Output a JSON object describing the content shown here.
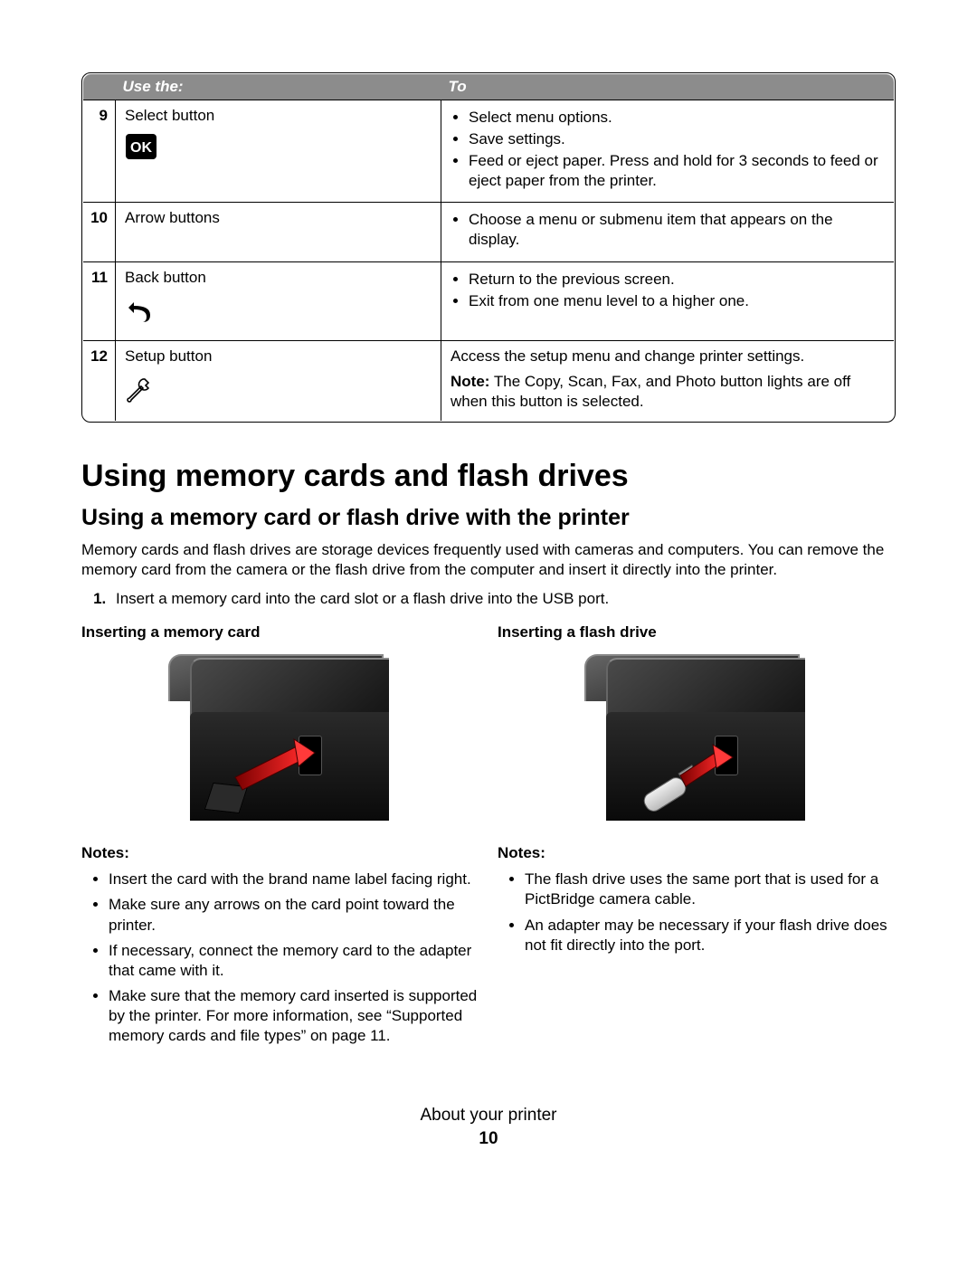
{
  "table": {
    "headers": {
      "num": "",
      "use": "Use the:",
      "to": "To"
    },
    "rows": [
      {
        "num": "9",
        "use": "Select button",
        "icon": "ok-icon",
        "to_items": [
          "Select menu options.",
          "Save settings.",
          "Feed or eject paper. Press and hold for 3 seconds to feed or eject paper from the printer."
        ]
      },
      {
        "num": "10",
        "use": "Arrow buttons",
        "to_items": [
          "Choose a menu or submenu item that appears on the display."
        ]
      },
      {
        "num": "11",
        "use": "Back button",
        "icon": "back-icon",
        "to_items": [
          "Return to the previous screen.",
          "Exit from one menu level to a higher one."
        ]
      },
      {
        "num": "12",
        "use": "Setup button",
        "icon": "wrench-icon",
        "to_text": "Access the setup menu and change printer settings.",
        "to_note_label": "Note:",
        "to_note_text": " The Copy, Scan, Fax, and Photo button lights are off when this button is selected."
      }
    ]
  },
  "h1": "Using memory cards and flash drives",
  "h2": "Using a memory card or flash drive with the printer",
  "intro": "Memory cards and flash drives are storage devices frequently used with cameras and computers. You can remove the memory card from the camera or the flash drive from the computer and insert it directly into the printer.",
  "step1": "Insert a memory card into the card slot or a flash drive into the USB port.",
  "left": {
    "head": "Inserting a memory card",
    "notes_label": "Notes:",
    "notes": [
      "Insert the card with the brand name label facing right.",
      "Make sure any arrows on the card point toward the printer.",
      "If necessary, connect the memory card to the adapter that came with it.",
      "Make sure that the memory card inserted is supported by the printer. For more information, see “Supported memory cards and file types” on page 11."
    ]
  },
  "right": {
    "head": "Inserting a flash drive",
    "notes_label": "Notes:",
    "notes": [
      "The flash drive uses the same port that is used for a PictBridge camera cable.",
      "An adapter may be necessary if your flash drive does not fit directly into the port."
    ]
  },
  "footer": {
    "chapter": "About your printer",
    "page": "10"
  }
}
